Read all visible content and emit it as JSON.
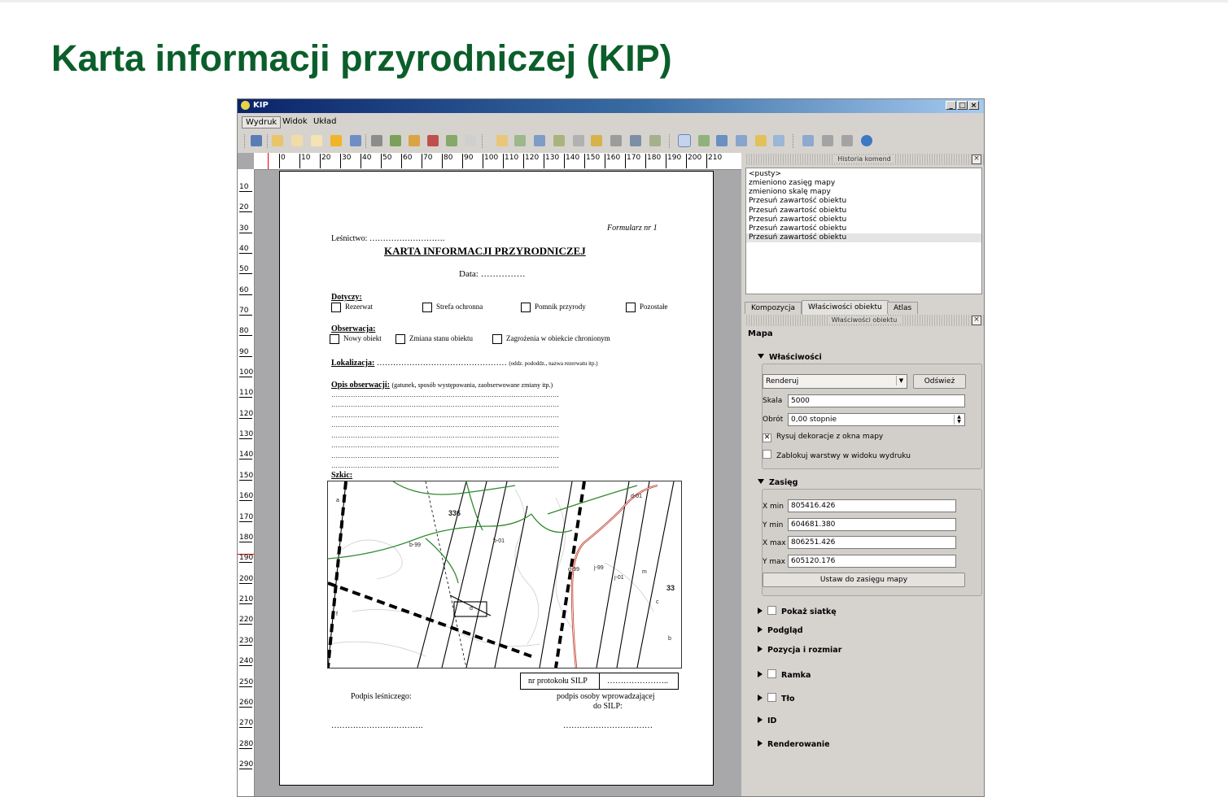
{
  "slide_title": "Karta informacji przyrodniczej (KIP)",
  "window": {
    "title": "KIP",
    "min": "_",
    "max": "□",
    "close": "×"
  },
  "menu": [
    "Wydruk",
    "Widok",
    "Układ"
  ],
  "ruler": {
    "h": [
      "0",
      "10",
      "20",
      "30",
      "40",
      "50",
      "60",
      "70",
      "80",
      "90",
      "100",
      "110",
      "120",
      "130",
      "140",
      "150",
      "160",
      "170",
      "180",
      "190",
      "200",
      "210"
    ],
    "v": [
      "10",
      "20",
      "30",
      "40",
      "50",
      "60",
      "70",
      "80",
      "90",
      "100",
      "110",
      "120",
      "130",
      "140",
      "150",
      "160",
      "170",
      "180",
      "190",
      "200",
      "210",
      "220",
      "230",
      "240",
      "250",
      "260",
      "270",
      "280",
      "290"
    ]
  },
  "form": {
    "formularz": "Formularz nr 1",
    "lesnictwo": "Leśnictwo: ……………………….",
    "title": "KARTA INFORMACJI PRZYRODNICZEJ",
    "data": "Data: ……………",
    "dotyczy": "Dotyczy:",
    "dotyczy_options": [
      "Rezerwat",
      "Strefa ochronna",
      "Pomnik przyrody",
      "Pozostałe"
    ],
    "obserwacja": "Obserwacja:",
    "obserwacja_options": [
      "Nowy obiekt",
      "Zmiana stanu obiektu",
      "Zagrożenia w obiekcie chronionym"
    ],
    "lokalizacja": "Lokalizacja:",
    "lokalizacja_dots": "…………………………………………",
    "lokalizacja_hint": "(oddz. pododdz., nazwa rezerwatu itp.)",
    "opis": "Opis obserwacji:",
    "opis_hint": "(gatunek, sposób występowania, zaobserwowane zmiany itp.)",
    "dotted_line": "……………………………………………………………………………………………",
    "szkic": "Szkic:",
    "nr_protokolu": "nr protokołu SILP",
    "nr_protokolu_dots": "…………………..",
    "podpis_lesniczego": "Podpis leśniczego:",
    "podpis_osoby_1": "podpis osoby wprowadzającej",
    "podpis_osoby_2": "do SILP:",
    "sign_dots_left": "…………………………….",
    "sign_dots_right": "……………………………"
  },
  "sketch_labels": [
    "a",
    "336",
    "b-99",
    "b-01",
    "d",
    "d-99",
    "j-99",
    "j-01",
    "m",
    "c",
    "f",
    "b",
    "d-01",
    "33"
  ],
  "history": {
    "header": "Historia komend",
    "items": [
      "<pusty>",
      "zmieniono zasięg mapy",
      "zmieniono skalę mapy",
      "Przesuń zawartość obiektu",
      "Przesuń zawartość obiektu",
      "Przesuń zawartość obiektu",
      "Przesuń zawartość obiektu",
      "Przesuń zawartość obiektu"
    ],
    "selected_index": 7
  },
  "tabs": [
    "Kompozycja",
    "Właściwości obiektu",
    "Atlas"
  ],
  "active_tab": 1,
  "props": {
    "header": "Właściwości obiektu",
    "section": "Mapa",
    "wlasciwosci": {
      "label": "Właściwości",
      "render_value": "Renderuj",
      "refresh": "Odśwież",
      "skala_label": "Skala",
      "skala_value": "5000",
      "obrot_label": "Obrót",
      "obrot_value": "0,00 stopnie",
      "rysuj_label": "Rysuj dekoracje z okna mapy",
      "rysuj_checked": true,
      "zablokuj_label": "Zablokuj warstwy w widoku wydruku",
      "zablokuj_checked": false
    },
    "zasieg": {
      "label": "Zasięg",
      "xmin_label": "X min",
      "xmin": "805416.426",
      "ymin_label": "Y min",
      "ymin": "604681.380",
      "xmax_label": "X max",
      "xmax": "806251.426",
      "ymax_label": "Y max",
      "ymax": "605120.176",
      "button": "Ustaw do zasięgu mapy"
    },
    "collapsed": [
      "Pokaż siatkę",
      "Podgląd",
      "Pozycja i rozmiar",
      "Ramka",
      "Tło",
      "ID",
      "Renderowanie"
    ]
  },
  "colors": {
    "title_green": "#0b5e2a",
    "map_green": "#2e8b2e",
    "map_red": "#c0392b"
  }
}
